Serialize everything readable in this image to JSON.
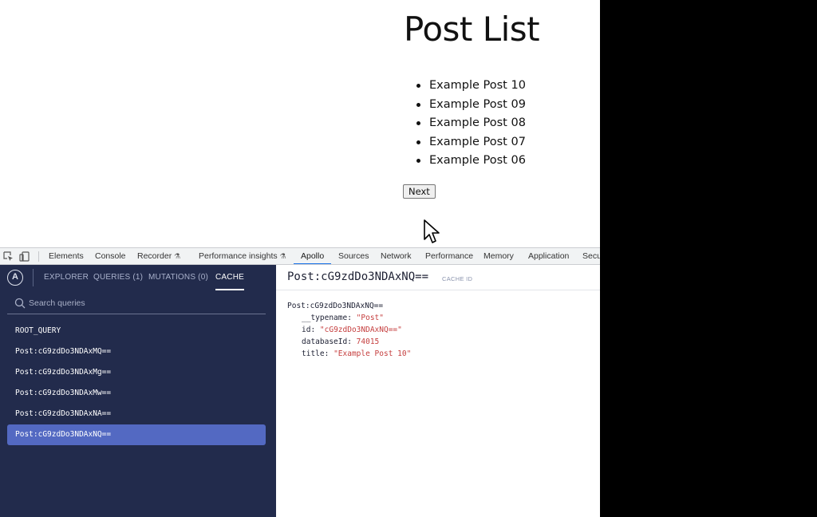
{
  "webpage": {
    "title": "Post List",
    "posts": [
      "Example Post 10",
      "Example Post 09",
      "Example Post 08",
      "Example Post 07",
      "Example Post 06"
    ],
    "next_label": "Next"
  },
  "devtools": {
    "tabs": [
      {
        "label": "Elements"
      },
      {
        "label": "Console"
      },
      {
        "label": "Recorder",
        "experimental": true
      },
      {
        "label": "Performance insights",
        "experimental": true
      },
      {
        "label": "Apollo",
        "active": true
      },
      {
        "label": "Sources"
      },
      {
        "label": "Network"
      },
      {
        "label": "Performance"
      },
      {
        "label": "Memory"
      },
      {
        "label": "Application"
      },
      {
        "label": "Secu"
      }
    ]
  },
  "apollo": {
    "logo": "A",
    "nav": {
      "explorer": "EXPLORER",
      "queries": "QUERIES (1)",
      "mutations": "MUTATIONS (0)",
      "cache": "CACHE"
    },
    "search_placeholder": "Search queries",
    "cache_items": [
      "ROOT_QUERY",
      "Post:cG9zdDo3NDAxMQ==",
      "Post:cG9zdDo3NDAxMg==",
      "Post:cG9zdDo3NDAxMw==",
      "Post:cG9zdDo3NDAxNA==",
      "Post:cG9zdDo3NDAxNQ=="
    ],
    "selected_index": 5,
    "detail": {
      "title": "Post:cG9zdDo3NDAxNQ==",
      "cache_id_label": "CACHE ID",
      "entry_name": "Post:cG9zdDo3NDAxNQ==",
      "fields": [
        {
          "key": "__typename",
          "value": "\"Post\""
        },
        {
          "key": "id",
          "value": "\"cG9zdDo3NDAxNQ==\""
        },
        {
          "key": "databaseId",
          "value": "74015"
        },
        {
          "key": "title",
          "value": "\"Example Post 10\""
        }
      ]
    }
  },
  "colors": {
    "sidebar_bg": "#222b4c",
    "selected_bg": "#5369c2",
    "value_red": "#c53e3e",
    "active_tab_underline": "#1a73e8"
  }
}
